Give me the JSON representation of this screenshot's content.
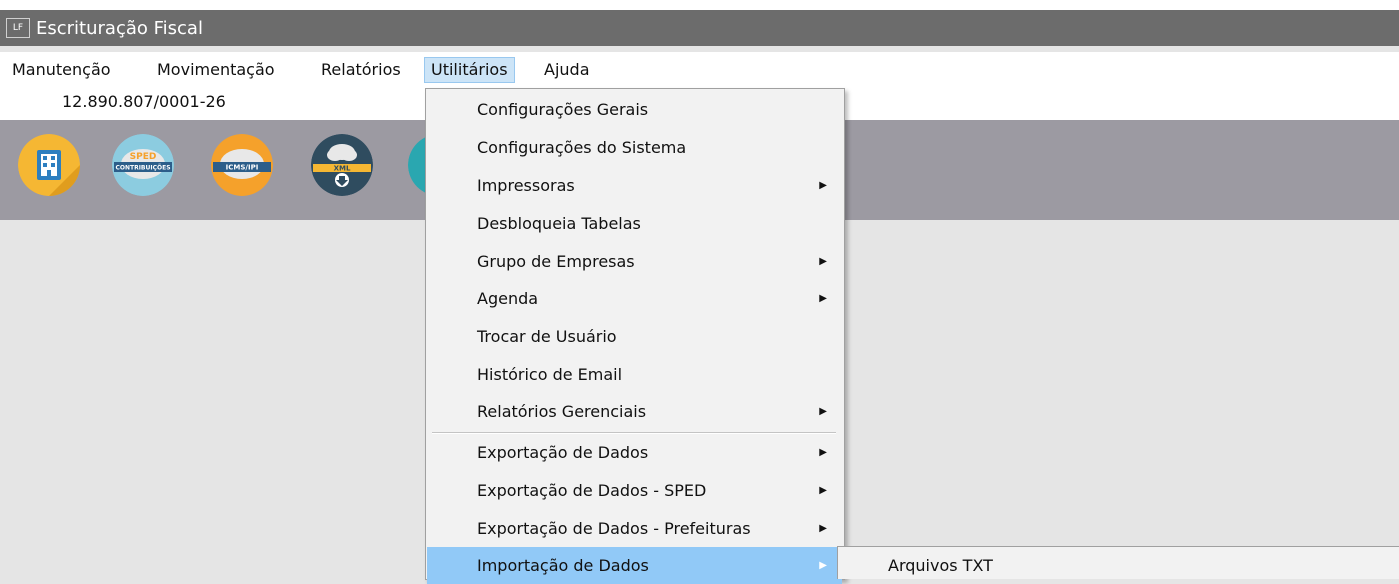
{
  "window": {
    "title": "Escrituração Fiscal",
    "icon_text": "LF"
  },
  "menubar": {
    "items": [
      {
        "label": "Manutenção"
      },
      {
        "label": "Movimentação"
      },
      {
        "label": "Relatórios"
      },
      {
        "label": "Utilitários",
        "active": true
      },
      {
        "label": "Ajuda"
      }
    ]
  },
  "company": {
    "cnpj": "12.890.807/0001-26"
  },
  "toolbar": {
    "buttons": [
      {
        "icon": "company-building-icon",
        "color": "#f5b733"
      },
      {
        "icon": "sped-contribuicoes-icon",
        "color": "#8ccce0",
        "text_top": "SPED",
        "text_band": "CONTRIBUIÇÕES"
      },
      {
        "icon": "icms-ipi-icon",
        "color": "#f5a12b",
        "text_band": "ICMS/IPI"
      },
      {
        "icon": "xml-download-icon",
        "color": "#2f4c5f",
        "text_band": "XML"
      },
      {
        "icon": "teal-icon",
        "color": "#2aa7b0"
      }
    ]
  },
  "dropdown": {
    "items": [
      {
        "label": "Configurações Gerais",
        "submenu": false
      },
      {
        "label": "Configurações do Sistema",
        "submenu": false
      },
      {
        "label": "Impressoras",
        "submenu": true
      },
      {
        "label": "Desbloqueia Tabelas",
        "submenu": false
      },
      {
        "label": "Grupo de Empresas",
        "submenu": true
      },
      {
        "label": "Agenda",
        "submenu": true
      },
      {
        "label": "Trocar de Usuário",
        "submenu": false
      },
      {
        "label": "Histórico de Email",
        "submenu": false
      },
      {
        "label": "Relatórios Gerenciais",
        "submenu": true
      },
      {
        "label": "Exportação de Dados",
        "submenu": true
      },
      {
        "label": "Exportação de Dados - SPED",
        "submenu": true
      },
      {
        "label": "Exportação de Dados - Prefeituras",
        "submenu": true
      },
      {
        "label": "Importação de Dados",
        "submenu": true,
        "highlighted": true
      }
    ]
  },
  "submenu": {
    "items": [
      {
        "label": "Arquivos TXT"
      }
    ]
  },
  "colors": {
    "titlebar": "#6c6c6c",
    "toolbar": "#9c9aa2",
    "menu_highlight": "#91c9f7",
    "menu_active": "#cce4f7"
  }
}
